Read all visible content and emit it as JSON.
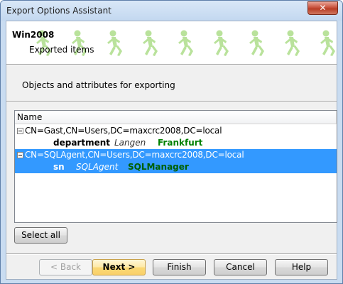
{
  "window": {
    "title": "Export Options Assistant",
    "close_label": "✕"
  },
  "header": {
    "title": "Win2008",
    "subtitle": "Exported items"
  },
  "section_label": "Objects and attributes for exporting",
  "tree": {
    "column_header": "Name",
    "rows": [
      {
        "node": "CN=Gast,CN=Users,DC=maxcrc2008,DC=local",
        "selected": false,
        "attribute": {
          "name": "department",
          "old_value": "Langen",
          "new_value": "Frankfurt"
        }
      },
      {
        "node": "CN=SQLAgent,CN=Users,DC=maxcrc2008,DC=local",
        "selected": true,
        "attribute": {
          "name": "sn",
          "old_value": "SQLAgent",
          "new_value": "SQLManager"
        }
      }
    ]
  },
  "buttons": {
    "select_all": "Select all",
    "back": "< Back",
    "next": "Next >",
    "finish": "Finish",
    "cancel": "Cancel",
    "help": "Help"
  },
  "colors": {
    "selection": "#3399ff",
    "new_value": "#008000",
    "header_figures": "#b9e29b"
  }
}
